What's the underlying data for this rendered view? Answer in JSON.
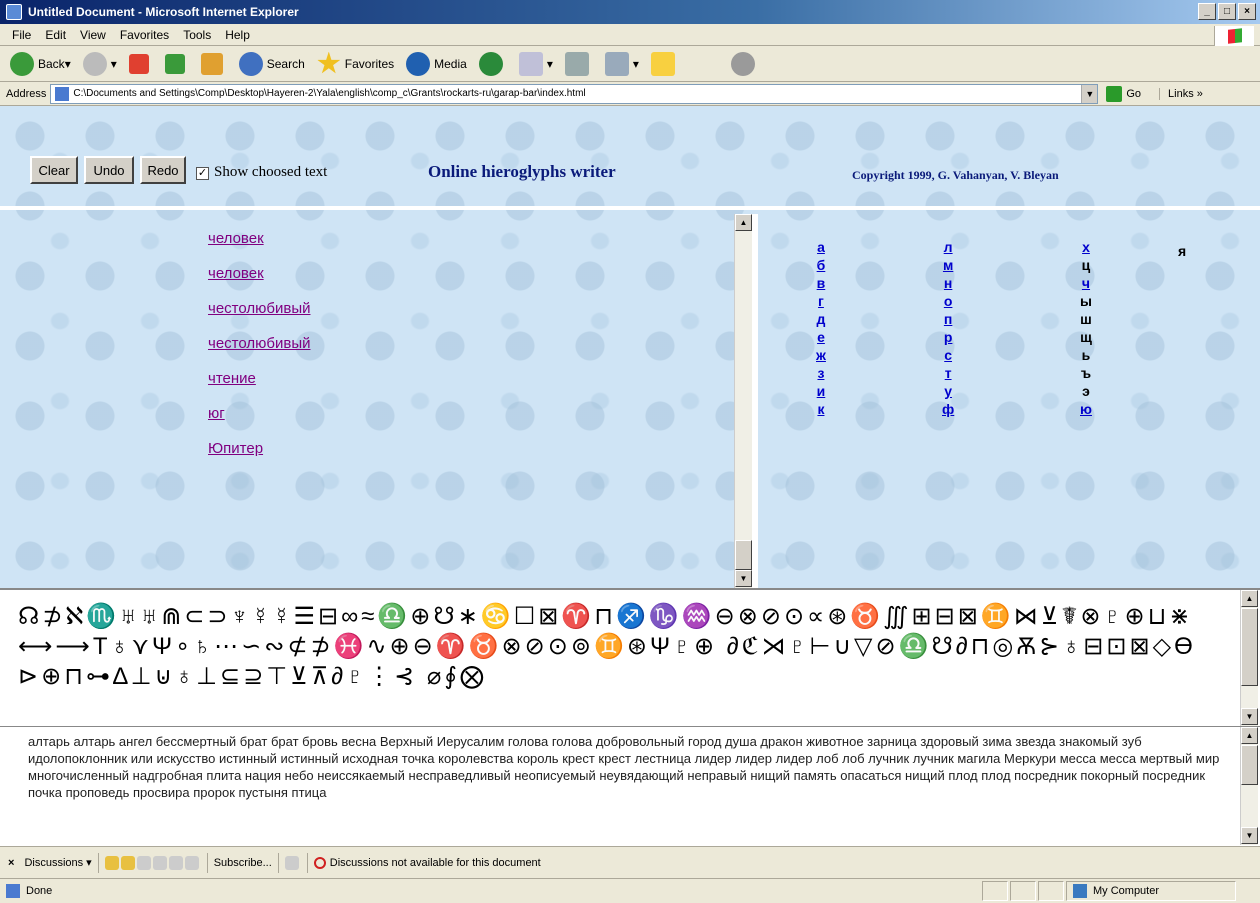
{
  "window": {
    "title": "Untitled Document - Microsoft Internet Explorer"
  },
  "menu": [
    "File",
    "Edit",
    "View",
    "Favorites",
    "Tools",
    "Help"
  ],
  "toolbar": {
    "back": "Back",
    "search": "Search",
    "favorites": "Favorites",
    "media": "Media"
  },
  "address": {
    "label": "Address",
    "url": "C:\\Documents and Settings\\Comp\\Desktop\\Hayeren-2\\Yala\\english\\comp_c\\Grants\\rockarts-ru\\garap-bar\\index.html",
    "go": "Go",
    "links": "Links"
  },
  "page": {
    "buttons": {
      "clear": "Clear",
      "undo": "Undo",
      "redo": "Redo"
    },
    "show_chosen": "Show choosed text",
    "title": "Online hieroglyphs writer",
    "copyright": "Copyright 1999, G. Vahanyan, V. Bleyan",
    "words": [
      "человек",
      "человек",
      "честолюбивый",
      "честолюбивый",
      "чтение",
      "юг",
      "Юпитер"
    ],
    "alphabet": {
      "col1": [
        "а",
        "б",
        "в",
        "г",
        "д",
        "е",
        "ж",
        "з",
        "и",
        "к"
      ],
      "col2": [
        "л",
        "м",
        "н",
        "о",
        "п",
        "р",
        "с",
        "т",
        "у",
        "ф"
      ],
      "col3": [
        "х",
        "ц",
        "ч",
        "ы",
        "ш",
        "щ",
        "ь",
        "ъ",
        "э",
        "ю"
      ],
      "col4": [
        "я"
      ]
    },
    "glyphs": "☊⊅ℵ♏♅♅⋒⊂⊃♆☿☿☰⊟∞≈♎⊕☋∗♋☐⊠♈⊓♐♑♒⊖⊗⊘⊙∝⊛♉∭⊞⊟⊠♊⋈⊻☤⊗♇⊕⊔⋇ ⟷⟶T♁⋎Ψ∘♄⋯∽∾⊄⊅♓∿⊕⊖♈♉⊗⊘⊙⊚♊⊛Ψ♇⊕ ∂ℭ⋊♇⊢∪▽⊘♎☋∂⊓◎Ѫ⊱♁⊟⊡⊠◇ϴ⊳⊕⊓⊶∆⊥⊍♁⊥⊆⊇⊤⊻⊼∂♇⋮⊰ ⌀∮⨂",
    "wordlist": "алтарь алтарь ангел бессмертный брат брат бровь весна Верхный Иерусалим голова голова добровольный город душа дракон животное зарница здоровый зима звезда знакомый зуб идолопоклонник или искусство истинный истинный исходная точка королевства король крест крест лестница лидер лидер лидер лоб лоб лучник лучник магила Меркури месса месса мертвый мир многочисленный надгробная плита нация небо неиссякаемый несправедливый неописуемый неувядающий неправый нищий память опасаться нищий плод плод посредник покорный посредник почка проповедь просвира пророк пустыня птица"
  },
  "discussions": {
    "label": "Discussions",
    "subscribe": "Subscribe...",
    "status": "Discussions not available for this document"
  },
  "status": {
    "text": "Done",
    "zone": "My Computer"
  }
}
